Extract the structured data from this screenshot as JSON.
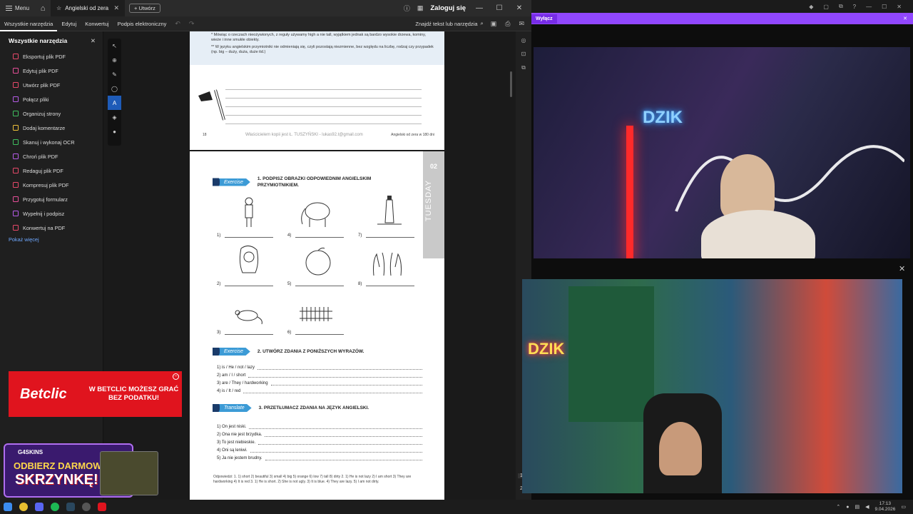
{
  "titlebar": {
    "menu_label": "Menu",
    "tab_title": "Angielski od zera w ...",
    "new_tab_label": "Utwórz",
    "sign_in": "Zaloguj się"
  },
  "toolbar": {
    "tabs": [
      "Wszystkie narzędzia",
      "Edytuj",
      "Konwertuj",
      "Podpis elektroniczny"
    ],
    "search_label": "Znajdź tekst lub narzędzia"
  },
  "sidebar": {
    "title": "Wszystkie narzędzia",
    "items": [
      {
        "label": "Eksportuj plik PDF",
        "color": "#e8496a"
      },
      {
        "label": "Edytuj plik PDF",
        "color": "#e84f9a"
      },
      {
        "label": "Utwórz plik PDF",
        "color": "#e8496a"
      },
      {
        "label": "Połącz pliki",
        "color": "#b65ce8"
      },
      {
        "label": "Organizuj strony",
        "color": "#3fbf5f"
      },
      {
        "label": "Dodaj komentarze",
        "color": "#f0c23a"
      },
      {
        "label": "Skanuj i wykonaj OCR",
        "color": "#3fbf5f"
      },
      {
        "label": "Chroń plik PDF",
        "color": "#b65ce8"
      },
      {
        "label": "Redaguj plik PDF",
        "color": "#e8496a"
      },
      {
        "label": "Kompresuj plik PDF",
        "color": "#e8496a"
      },
      {
        "label": "Przygotuj formularz",
        "color": "#e84f9a"
      },
      {
        "label": "Wypełnij i podpisz",
        "color": "#b65ce8"
      },
      {
        "label": "Konwertuj na PDF",
        "color": "#e8496a"
      }
    ],
    "show_more": "Pokaż więcej"
  },
  "page1": {
    "note1": "* Mówiąc o rzeczach nieożywionych, z reguły używamy high a nie tall, wyjątkiem jednak są bardzo wysokie drzewa, kominy, wieże i inne smukłe obiekty.",
    "note2": "** W języku angielskim przymiotniki nie odmieniają się, czyli pozostają niezmienne, bez względu na liczbę, rodzaj czy przypadek (np. big – duży, duża, duże itd.)",
    "page_number": "18",
    "watermark": "Właścicielem kopii jest Ł. TUSZYŃSKI - lukas92.t@gmail.com",
    "footer_right": "Angielski od zera w 180 dni"
  },
  "page2": {
    "week": "02",
    "day": "TUESDAY",
    "ex1": {
      "badge": "Exercise",
      "number": "1.",
      "title": "PODPISZ OBRAZKI ODPOWIEDNIM ANGIELSKIM PRZYMIOTNIKIEM."
    },
    "ex2": {
      "badge": "Exercise",
      "number": "2.",
      "title": "UTWÓRZ ZDANIA Z PONIŻSZYCH WYRAZÓW."
    },
    "ex3": {
      "badge": "Translate",
      "number": "3.",
      "title": "PRZETŁUMACZ ZDANIA NA JĘZYK ANGIELSKI."
    },
    "pic_numbers": [
      "1)",
      "4)",
      "7)",
      "2)",
      "5)",
      "8)",
      "3)",
      "6)"
    ],
    "ex2_items": [
      "1)  is / He / not / lazy",
      "2)  am / I / short",
      "3)  are / They / hardworking",
      "4)  is / It / red"
    ],
    "ex3_items": [
      "1)  On jest niski.",
      "2)  Ona nie jest brzydka.",
      "3)  To jest niebieskie.",
      "4)  Oni są leniwi.",
      "5)  Ja nie jestem brudny."
    ],
    "answers": "Odpowiedzi: 1. 1) short 2) beautiful 3) small 4) big 5) orange 6) low 7) tall 8) dirty 2. 1) He is not lazy 2) I am short 3) They are hardworking 4) It is red 3. 1) He is short. 2) She is not ugly. 3) It is blue. 4) They are lazy. 5) I am not dirty."
  },
  "page_indicator": [
    "1",
    "2"
  ],
  "ads": {
    "betclic_logo": "Betclic",
    "betclic_tag": "W BETCLIC MOŻESZ GRAĆ BEZ PODATKU!",
    "skins_brand": "G4SKINS",
    "skins_line1": "ODBIERZ DARMOWĄ",
    "skins_line2": "SKRZYNKĘ!"
  },
  "stream": {
    "banner_button": "Wyłącz",
    "neon_sign": "DZIK",
    "neon_sign2": "DZIK"
  },
  "taskbar": {
    "time": "17:13",
    "date": "9.04.2026"
  }
}
